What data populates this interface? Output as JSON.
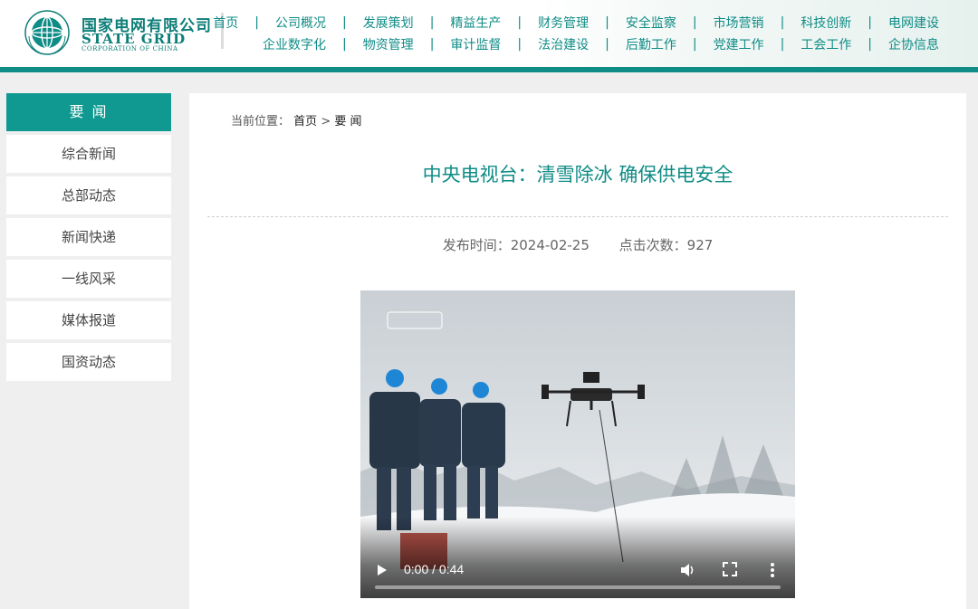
{
  "brand": {
    "name_cn": "国家电网有限公司",
    "name_en": "STATE GRID",
    "name_en_sub": "CORPORATION OF CHINA"
  },
  "nav": {
    "row1": [
      "首页",
      "公司概况",
      "发展策划",
      "精益生产",
      "财务管理",
      "安全监察",
      "市场营销",
      "科技创新",
      "电网建设"
    ],
    "row2": [
      "企业数字化",
      "物资管理",
      "审计监督",
      "法治建设",
      "后勤工作",
      "党建工作",
      "工会工作",
      "企协信息"
    ]
  },
  "sidebar": {
    "heading": "要 闻",
    "items": [
      "综合新闻",
      "总部动态",
      "新闻快递",
      "一线风采",
      "媒体报道",
      "国资动态"
    ]
  },
  "breadcrumb": {
    "prefix": "当前位置：",
    "home": "首页",
    "sep": ">",
    "current": "要 闻"
  },
  "article": {
    "title": "中央电视台：清雪除冰 确保供电安全",
    "publish_label": "发布时间：2024-02-25",
    "views_label": "点击次数：927"
  },
  "video": {
    "time": "0:00 / 0:44",
    "progress": 0
  },
  "colors": {
    "brand": "#0f8c86",
    "sidebar_active": "#0f9990"
  }
}
